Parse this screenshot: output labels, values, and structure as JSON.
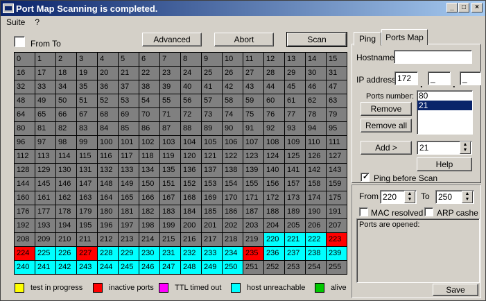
{
  "window": {
    "title": "Port Map Scanning is completed."
  },
  "titlebar_buttons": {
    "minimize": "_",
    "maximize": "□",
    "close": "×"
  },
  "menu": [
    "Suite",
    "?"
  ],
  "toolbar": {
    "from_to_label": "From To",
    "advanced": "Advanced",
    "abort": "Abort",
    "scan": "Scan"
  },
  "colors": {
    "gray": "#808080",
    "cyan": "#00ffff",
    "red": "#ff0000",
    "yellow": "#ffff00",
    "magenta": "#ff00ff",
    "green": "#00c800"
  },
  "ports": {
    "count": 256,
    "cyan": [
      220,
      221,
      222,
      225,
      226,
      228,
      229,
      230,
      231,
      232,
      233,
      234,
      236,
      237,
      238,
      239,
      240,
      241,
      242,
      243,
      244,
      245,
      246,
      247,
      248,
      249,
      250
    ],
    "red": [
      223,
      224,
      227,
      235
    ]
  },
  "legend": [
    {
      "label": "test in progress",
      "color": "#ffff00"
    },
    {
      "label": "inactive ports",
      "color": "#ff0000"
    },
    {
      "label": "TTL timed out",
      "color": "#ff00ff"
    },
    {
      "label": "host unreachable",
      "color": "#00ffff"
    },
    {
      "label": "alive",
      "color": "#00c800"
    }
  ],
  "tabs": {
    "ping": "Ping",
    "ports_map": "Ports Map"
  },
  "right": {
    "hostname_label": "Hostname",
    "hostname_value": "",
    "ip_label": "IP address",
    "ip1": "172",
    "ip2": "_",
    "ip3": "_",
    "ip_dot": ".",
    "ports_number_label": "Ports number:",
    "ports_list": [
      "80",
      "21"
    ],
    "remove": "Remove",
    "remove_all": "Remove all",
    "add": "Add >",
    "add_value": "21",
    "help": "Help",
    "ping_before_scan": "Ping before Scan",
    "from_label": "From",
    "from_value": "220",
    "to_label": "To",
    "to_value": "250",
    "mac_resolved": "MAC resolved",
    "arp_cashe": "ARP cashe",
    "ports_opened": "Ports are opened:",
    "save": "Save"
  }
}
